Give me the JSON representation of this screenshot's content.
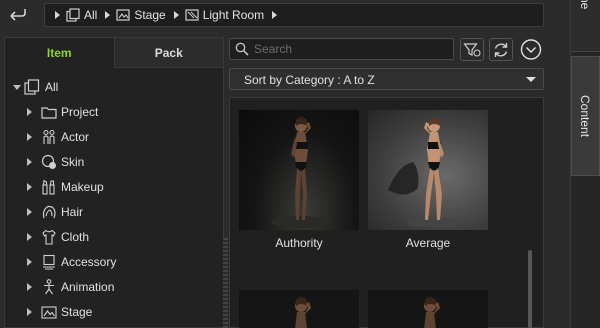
{
  "breadcrumb": {
    "items": [
      {
        "label": "All",
        "icon": "all-items-icon"
      },
      {
        "label": "Stage",
        "icon": "stage-icon"
      },
      {
        "label": "Light Room",
        "icon": "light-room-icon"
      }
    ]
  },
  "tabs": {
    "item": "Item",
    "pack": "Pack",
    "active": "item",
    "active_color": "#8fd13f"
  },
  "tree": {
    "root": {
      "label": "All",
      "icon": "all-items-icon",
      "expanded": true
    },
    "children": [
      {
        "label": "Project",
        "icon": "folder-icon"
      },
      {
        "label": "Actor",
        "icon": "actor-icon"
      },
      {
        "label": "Skin",
        "icon": "skin-icon"
      },
      {
        "label": "Makeup",
        "icon": "makeup-icon"
      },
      {
        "label": "Hair",
        "icon": "hair-icon"
      },
      {
        "label": "Cloth",
        "icon": "cloth-icon"
      },
      {
        "label": "Accessory",
        "icon": "accessory-icon"
      },
      {
        "label": "Animation",
        "icon": "animation-icon"
      },
      {
        "label": "Stage",
        "icon": "stage-icon"
      }
    ]
  },
  "search": {
    "placeholder": "Search",
    "value": ""
  },
  "sort": {
    "selected": "Sort by Category : A to Z"
  },
  "content_items": [
    {
      "caption": "Authority",
      "lighting": "dark"
    },
    {
      "caption": "Average",
      "lighting": "bright"
    },
    {
      "caption": "",
      "lighting": "dark"
    },
    {
      "caption": "",
      "lighting": "dark"
    }
  ],
  "side_tabs": {
    "top_label": "ne",
    "content_label": "Content"
  }
}
